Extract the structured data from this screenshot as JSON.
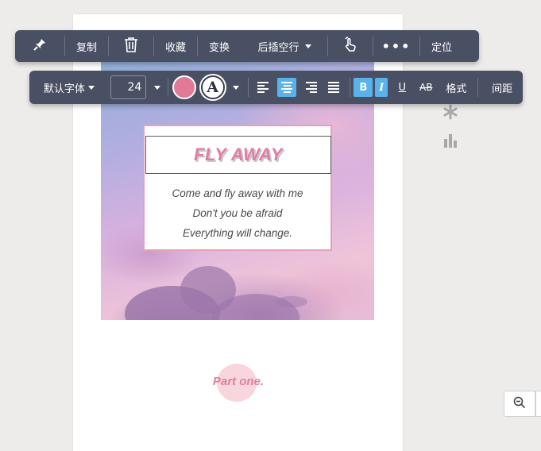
{
  "toolbar_top": {
    "pin_icon": "pin-icon",
    "copy_label": "复制",
    "delete_icon": "trash-icon",
    "collect_label": "收藏",
    "transform_label": "变换",
    "insert_blank_label": "后插空行",
    "hand_icon": "pointer-hand-icon",
    "more_label": "•••",
    "locate_label": "定位"
  },
  "toolbar_format": {
    "font_family": "默认字体",
    "font_size": "24",
    "text_color": "#e07a97",
    "bg_letter": "A",
    "bold_label": "B",
    "italic_label": "I",
    "underline_label": "U",
    "strike_label": "AB",
    "format_label": "格式",
    "spacing_label": "间距",
    "active_color": "#5ab2ec"
  },
  "canvas": {
    "title": "FLY AWAY",
    "lines": [
      "Come and fly away with me",
      "Don't you be afraid",
      "Everything will change."
    ],
    "part_label": "Part one."
  },
  "side_icons": [
    "snowflake-icon",
    "bar-chart-icon"
  ],
  "zoom": {
    "icon": "zoom-out-icon"
  }
}
